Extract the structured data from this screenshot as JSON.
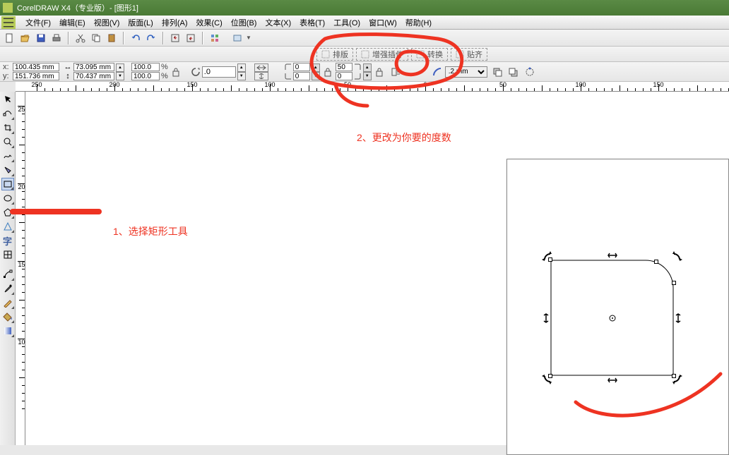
{
  "title": "CorelDRAW X4（专业版）- [图形1]",
  "menu": {
    "file": "文件(F)",
    "edit": "编辑(E)",
    "view": "视图(V)",
    "layout": "版面(L)",
    "arrange": "排列(A)",
    "effects": "效果(C)",
    "bitmap": "位图(B)",
    "text": "文本(X)",
    "table": "表格(T)",
    "tools": "工具(O)",
    "window": "窗口(W)",
    "help": "帮助(H)"
  },
  "drops": {
    "arrange": "排版",
    "enhance": "增强插件",
    "transform": "转换",
    "align": "贴齐"
  },
  "coords": {
    "x_label": "x:",
    "x": "100.435 mm",
    "y_label": "y:",
    "y": "151.736 mm",
    "w": "73.095 mm",
    "h": "70.437 mm",
    "sx": "100.0",
    "sy": "100.0",
    "pct": "%",
    "rot": ".0",
    "c_tl": "0",
    "c_bl": "0",
    "c_tr": "50",
    "c_br": "0",
    "outline": ".2 mm"
  },
  "ruler_h": [
    {
      "px": 30,
      "v": "250"
    },
    {
      "px": 140,
      "v": "200"
    },
    {
      "px": 250,
      "v": "150"
    },
    {
      "px": 360,
      "v": "100"
    },
    {
      "px": 470,
      "v": "50"
    },
    {
      "px": 580,
      "v": "0"
    },
    {
      "px": 690,
      "v": "50"
    },
    {
      "px": 800,
      "v": "100"
    },
    {
      "px": 910,
      "v": "150"
    }
  ],
  "ruler_v": [
    {
      "px": 20,
      "v": "250"
    },
    {
      "px": 130,
      "v": "200"
    },
    {
      "px": 240,
      "v": "150"
    },
    {
      "px": 350,
      "v": "100"
    }
  ],
  "anno": {
    "text1": "1、选择矩形工具",
    "text2": "2、更改为你要的度数"
  }
}
